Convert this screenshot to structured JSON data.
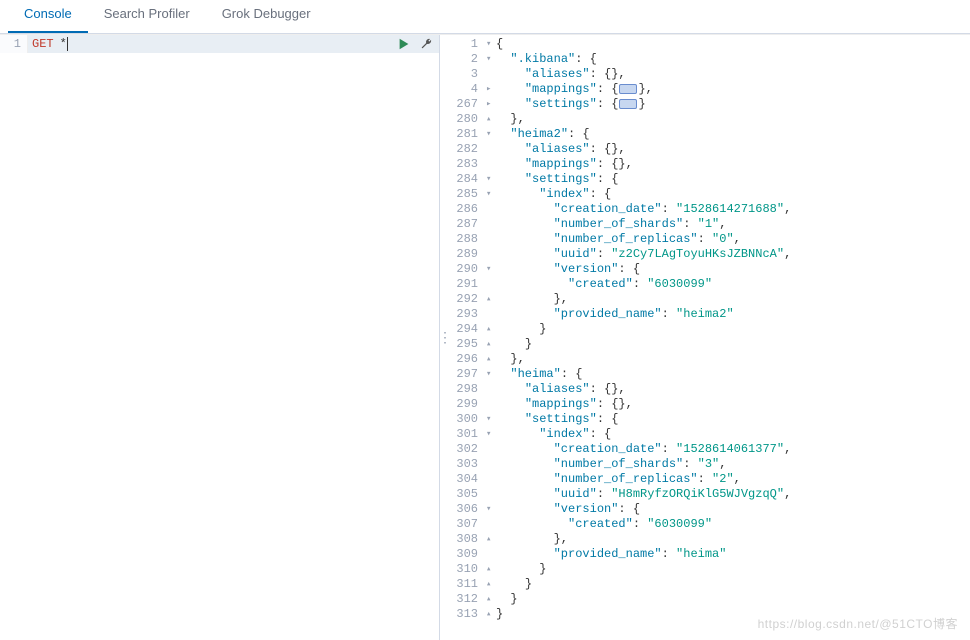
{
  "tabs": [
    {
      "label": "Console",
      "active": true
    },
    {
      "label": "Search Profiler",
      "active": false
    },
    {
      "label": "Grok Debugger",
      "active": false
    }
  ],
  "request": {
    "line_number": "1",
    "method": "GET",
    "path": "*"
  },
  "response_lines": [
    {
      "n": "1",
      "f": "▾",
      "indent": 0,
      "tokens": [
        {
          "t": "{",
          "c": "pun"
        }
      ]
    },
    {
      "n": "2",
      "f": "▾",
      "indent": 1,
      "tokens": [
        {
          "t": "\".kibana\"",
          "c": "key"
        },
        {
          "t": ": {",
          "c": "pun"
        }
      ]
    },
    {
      "n": "3",
      "f": "",
      "indent": 2,
      "tokens": [
        {
          "t": "\"aliases\"",
          "c": "key"
        },
        {
          "t": ": {},",
          "c": "pun"
        }
      ]
    },
    {
      "n": "4",
      "f": "▸",
      "indent": 2,
      "tokens": [
        {
          "t": "\"mappings\"",
          "c": "key"
        },
        {
          "t": ": {",
          "c": "pun"
        },
        {
          "badge": true
        },
        {
          "t": "},",
          "c": "pun"
        }
      ]
    },
    {
      "n": "267",
      "f": "▸",
      "indent": 2,
      "tokens": [
        {
          "t": "\"settings\"",
          "c": "key"
        },
        {
          "t": ": {",
          "c": "pun"
        },
        {
          "badge": true
        },
        {
          "t": "}",
          "c": "pun"
        }
      ]
    },
    {
      "n": "280",
      "f": "▴",
      "indent": 1,
      "tokens": [
        {
          "t": "},",
          "c": "pun"
        }
      ]
    },
    {
      "n": "281",
      "f": "▾",
      "indent": 1,
      "tokens": [
        {
          "t": "\"heima2\"",
          "c": "key"
        },
        {
          "t": ": {",
          "c": "pun"
        }
      ]
    },
    {
      "n": "282",
      "f": "",
      "indent": 2,
      "tokens": [
        {
          "t": "\"aliases\"",
          "c": "key"
        },
        {
          "t": ": {},",
          "c": "pun"
        }
      ]
    },
    {
      "n": "283",
      "f": "",
      "indent": 2,
      "tokens": [
        {
          "t": "\"mappings\"",
          "c": "key"
        },
        {
          "t": ": {},",
          "c": "pun"
        }
      ]
    },
    {
      "n": "284",
      "f": "▾",
      "indent": 2,
      "tokens": [
        {
          "t": "\"settings\"",
          "c": "key"
        },
        {
          "t": ": {",
          "c": "pun"
        }
      ]
    },
    {
      "n": "285",
      "f": "▾",
      "indent": 3,
      "tokens": [
        {
          "t": "\"index\"",
          "c": "key"
        },
        {
          "t": ": {",
          "c": "pun"
        }
      ]
    },
    {
      "n": "286",
      "f": "",
      "indent": 4,
      "tokens": [
        {
          "t": "\"creation_date\"",
          "c": "key"
        },
        {
          "t": ": ",
          "c": "pun"
        },
        {
          "t": "\"1528614271688\"",
          "c": "str"
        },
        {
          "t": ",",
          "c": "pun"
        }
      ]
    },
    {
      "n": "287",
      "f": "",
      "indent": 4,
      "tokens": [
        {
          "t": "\"number_of_shards\"",
          "c": "key"
        },
        {
          "t": ": ",
          "c": "pun"
        },
        {
          "t": "\"1\"",
          "c": "str"
        },
        {
          "t": ",",
          "c": "pun"
        }
      ]
    },
    {
      "n": "288",
      "f": "",
      "indent": 4,
      "tokens": [
        {
          "t": "\"number_of_replicas\"",
          "c": "key"
        },
        {
          "t": ": ",
          "c": "pun"
        },
        {
          "t": "\"0\"",
          "c": "str"
        },
        {
          "t": ",",
          "c": "pun"
        }
      ]
    },
    {
      "n": "289",
      "f": "",
      "indent": 4,
      "tokens": [
        {
          "t": "\"uuid\"",
          "c": "key"
        },
        {
          "t": ": ",
          "c": "pun"
        },
        {
          "t": "\"z2Cy7LAgToyuHKsJZBNNcA\"",
          "c": "str"
        },
        {
          "t": ",",
          "c": "pun"
        }
      ]
    },
    {
      "n": "290",
      "f": "▾",
      "indent": 4,
      "tokens": [
        {
          "t": "\"version\"",
          "c": "key"
        },
        {
          "t": ": {",
          "c": "pun"
        }
      ]
    },
    {
      "n": "291",
      "f": "",
      "indent": 5,
      "tokens": [
        {
          "t": "\"created\"",
          "c": "key"
        },
        {
          "t": ": ",
          "c": "pun"
        },
        {
          "t": "\"6030099\"",
          "c": "str"
        }
      ]
    },
    {
      "n": "292",
      "f": "▴",
      "indent": 4,
      "tokens": [
        {
          "t": "},",
          "c": "pun"
        }
      ]
    },
    {
      "n": "293",
      "f": "",
      "indent": 4,
      "tokens": [
        {
          "t": "\"provided_name\"",
          "c": "key"
        },
        {
          "t": ": ",
          "c": "pun"
        },
        {
          "t": "\"heima2\"",
          "c": "str"
        }
      ]
    },
    {
      "n": "294",
      "f": "▴",
      "indent": 3,
      "tokens": [
        {
          "t": "}",
          "c": "pun"
        }
      ]
    },
    {
      "n": "295",
      "f": "▴",
      "indent": 2,
      "tokens": [
        {
          "t": "}",
          "c": "pun"
        }
      ]
    },
    {
      "n": "296",
      "f": "▴",
      "indent": 1,
      "tokens": [
        {
          "t": "},",
          "c": "pun"
        }
      ]
    },
    {
      "n": "297",
      "f": "▾",
      "indent": 1,
      "tokens": [
        {
          "t": "\"heima\"",
          "c": "key"
        },
        {
          "t": ": {",
          "c": "pun"
        }
      ]
    },
    {
      "n": "298",
      "f": "",
      "indent": 2,
      "tokens": [
        {
          "t": "\"aliases\"",
          "c": "key"
        },
        {
          "t": ": {},",
          "c": "pun"
        }
      ]
    },
    {
      "n": "299",
      "f": "",
      "indent": 2,
      "tokens": [
        {
          "t": "\"mappings\"",
          "c": "key"
        },
        {
          "t": ": {},",
          "c": "pun"
        }
      ]
    },
    {
      "n": "300",
      "f": "▾",
      "indent": 2,
      "tokens": [
        {
          "t": "\"settings\"",
          "c": "key"
        },
        {
          "t": ": {",
          "c": "pun"
        }
      ]
    },
    {
      "n": "301",
      "f": "▾",
      "indent": 3,
      "tokens": [
        {
          "t": "\"index\"",
          "c": "key"
        },
        {
          "t": ": {",
          "c": "pun"
        }
      ]
    },
    {
      "n": "302",
      "f": "",
      "indent": 4,
      "tokens": [
        {
          "t": "\"creation_date\"",
          "c": "key"
        },
        {
          "t": ": ",
          "c": "pun"
        },
        {
          "t": "\"1528614061377\"",
          "c": "str"
        },
        {
          "t": ",",
          "c": "pun"
        }
      ]
    },
    {
      "n": "303",
      "f": "",
      "indent": 4,
      "tokens": [
        {
          "t": "\"number_of_shards\"",
          "c": "key"
        },
        {
          "t": ": ",
          "c": "pun"
        },
        {
          "t": "\"3\"",
          "c": "str"
        },
        {
          "t": ",",
          "c": "pun"
        }
      ]
    },
    {
      "n": "304",
      "f": "",
      "indent": 4,
      "tokens": [
        {
          "t": "\"number_of_replicas\"",
          "c": "key"
        },
        {
          "t": ": ",
          "c": "pun"
        },
        {
          "t": "\"2\"",
          "c": "str"
        },
        {
          "t": ",",
          "c": "pun"
        }
      ]
    },
    {
      "n": "305",
      "f": "",
      "indent": 4,
      "tokens": [
        {
          "t": "\"uuid\"",
          "c": "key"
        },
        {
          "t": ": ",
          "c": "pun"
        },
        {
          "t": "\"H8mRyfzORQiKlG5WJVgzqQ\"",
          "c": "str"
        },
        {
          "t": ",",
          "c": "pun"
        }
      ]
    },
    {
      "n": "306",
      "f": "▾",
      "indent": 4,
      "tokens": [
        {
          "t": "\"version\"",
          "c": "key"
        },
        {
          "t": ": {",
          "c": "pun"
        }
      ]
    },
    {
      "n": "307",
      "f": "",
      "indent": 5,
      "tokens": [
        {
          "t": "\"created\"",
          "c": "key"
        },
        {
          "t": ": ",
          "c": "pun"
        },
        {
          "t": "\"6030099\"",
          "c": "str"
        }
      ]
    },
    {
      "n": "308",
      "f": "▴",
      "indent": 4,
      "tokens": [
        {
          "t": "},",
          "c": "pun"
        }
      ]
    },
    {
      "n": "309",
      "f": "",
      "indent": 4,
      "tokens": [
        {
          "t": "\"provided_name\"",
          "c": "key"
        },
        {
          "t": ": ",
          "c": "pun"
        },
        {
          "t": "\"heima\"",
          "c": "str"
        }
      ]
    },
    {
      "n": "310",
      "f": "▴",
      "indent": 3,
      "tokens": [
        {
          "t": "}",
          "c": "pun"
        }
      ]
    },
    {
      "n": "311",
      "f": "▴",
      "indent": 2,
      "tokens": [
        {
          "t": "}",
          "c": "pun"
        }
      ]
    },
    {
      "n": "312",
      "f": "▴",
      "indent": 1,
      "tokens": [
        {
          "t": "}",
          "c": "pun"
        }
      ]
    },
    {
      "n": "313",
      "f": "▴",
      "indent": 0,
      "tokens": [
        {
          "t": "}",
          "c": "pun"
        }
      ]
    }
  ],
  "watermark": "https://blog.csdn.net/@51CTO博客"
}
